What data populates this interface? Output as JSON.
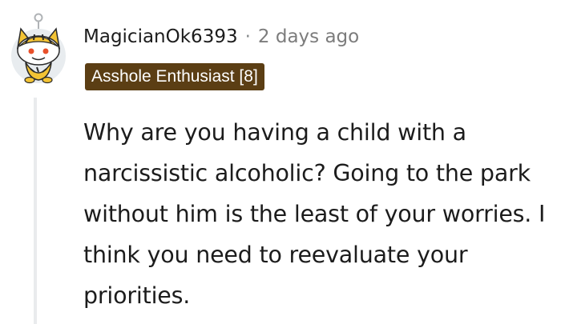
{
  "comment": {
    "author": "MagicianOk6393",
    "separator": "·",
    "timestamp": "2 days ago",
    "flair": "Asshole Enthusiast [8]",
    "body": "Why are you having a child with a narcissistic alcoholic? Going to the park without him is the least of your worries. I think you need to reevaluate your priorities."
  },
  "colors": {
    "flair_background": "#5b3e14",
    "flair_text": "#ffffff",
    "avatar_primary": "#f3c334",
    "avatar_background": "#e8ecef",
    "thread_line": "#e9ebed"
  },
  "icons": {
    "avatar": "snoo-avatar-icon"
  }
}
